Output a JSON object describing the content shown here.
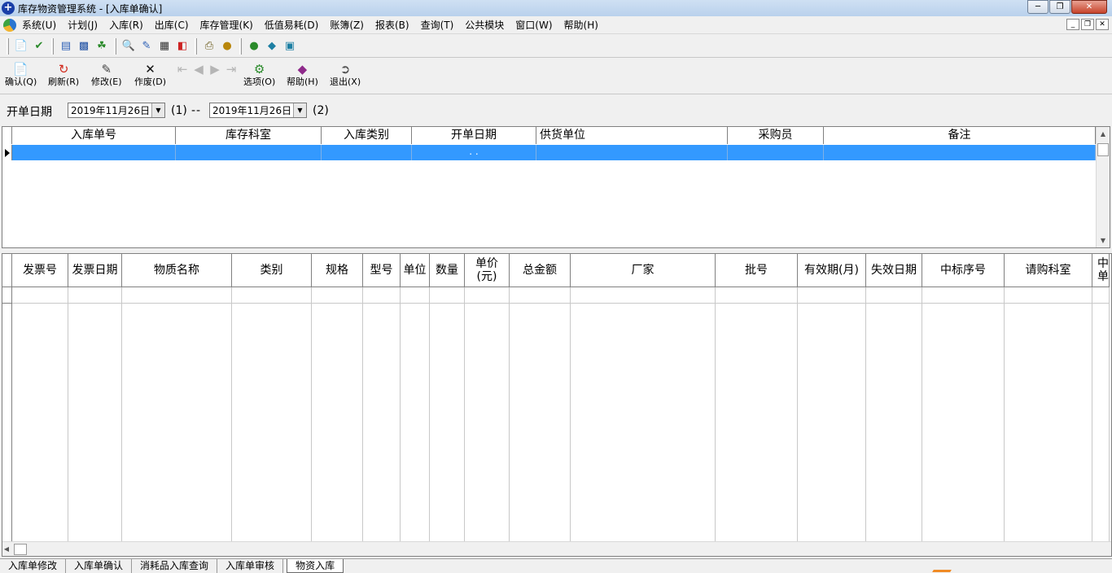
{
  "window": {
    "title": "库存物资管理系统 - [入库单确认]"
  },
  "menu": {
    "items": [
      "系统(U)",
      "计划(J)",
      "入库(R)",
      "出库(C)",
      "库存管理(K)",
      "低值易耗(D)",
      "账簿(Z)",
      "报表(B)",
      "查询(T)",
      "公共模块",
      "窗口(W)",
      "帮助(H)"
    ]
  },
  "toolbar": {
    "confirm": "确认(Q)",
    "refresh": "刷新(R)",
    "modify": "修改(E)",
    "void": "作废(D)",
    "options": "选项(O)",
    "help": "帮助(H)",
    "exit": "退出(X)"
  },
  "filter": {
    "label": "开单日期",
    "start_date": "2019年11月26日",
    "start_tag": "(1)",
    "separator": "--",
    "end_date": "2019年11月26日",
    "end_tag": "(2)"
  },
  "master_grid": {
    "columns": [
      "入库单号",
      "库存科室",
      "入库类别",
      "开单日期",
      "供货单位",
      "采购员",
      "备注"
    ],
    "row": [
      "",
      "",
      "",
      ". .",
      "",
      "",
      ""
    ]
  },
  "detail_grid": {
    "columns": [
      "发票号",
      "发票日期",
      "物质名称",
      "类别",
      "规格",
      "型号",
      "单位",
      "数量",
      "单价\n(元)",
      "总金额",
      "厂家",
      "批号",
      "有效期(月)",
      "失效日期",
      "中标序号",
      "请购科室",
      "中\n单"
    ]
  },
  "tabs": [
    "入库单修改",
    "入库单确认",
    "消耗品入库查询",
    "入库单审核",
    "物资入库"
  ],
  "active_tab": "物资入库",
  "colors": {
    "selection": "#3399ff",
    "accent": "#f08a24"
  }
}
